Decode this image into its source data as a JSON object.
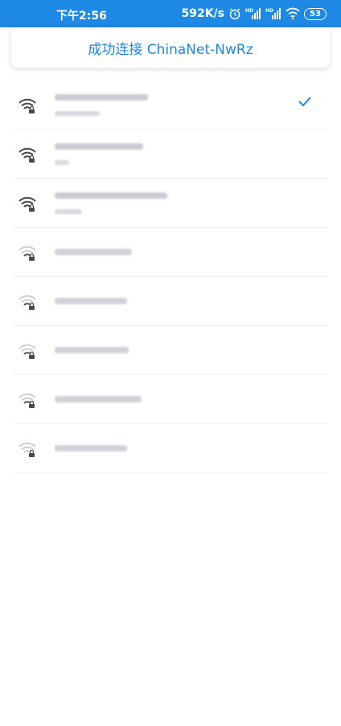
{
  "status_bar": {
    "time": "下午2:56",
    "net_speed": "592K/s",
    "battery": "53",
    "icons": [
      "alarm-icon",
      "hd-signal-icon",
      "hd-signal-icon",
      "wifi-icon",
      "battery-icon"
    ]
  },
  "toast": {
    "message": "成功连接 ChinaNet-NwRz"
  },
  "colors": {
    "accent": "#1e88e5",
    "wifi_strong": "#4a4a4a",
    "wifi_weak": "#bdbdbd"
  },
  "networks": [
    {
      "name": "[blurred]",
      "status": "[blurred]",
      "connected": true,
      "signal": "strong"
    },
    {
      "name": "[blurred]",
      "status": "[blurred]",
      "connected": false,
      "signal": "strong"
    },
    {
      "name": "[blurred]",
      "status": "[blurred]",
      "connected": false,
      "signal": "strong"
    },
    {
      "name": "[blurred]",
      "status": "",
      "connected": false,
      "signal": "weak"
    },
    {
      "name": "[blurred]",
      "status": "",
      "connected": false,
      "signal": "weak"
    },
    {
      "name": "[blurred]",
      "status": "",
      "connected": false,
      "signal": "weak"
    },
    {
      "name": "[blurred]",
      "status": "",
      "connected": false,
      "signal": "weak"
    },
    {
      "name": "[blurred]",
      "status": "",
      "connected": false,
      "signal": "weak"
    }
  ]
}
